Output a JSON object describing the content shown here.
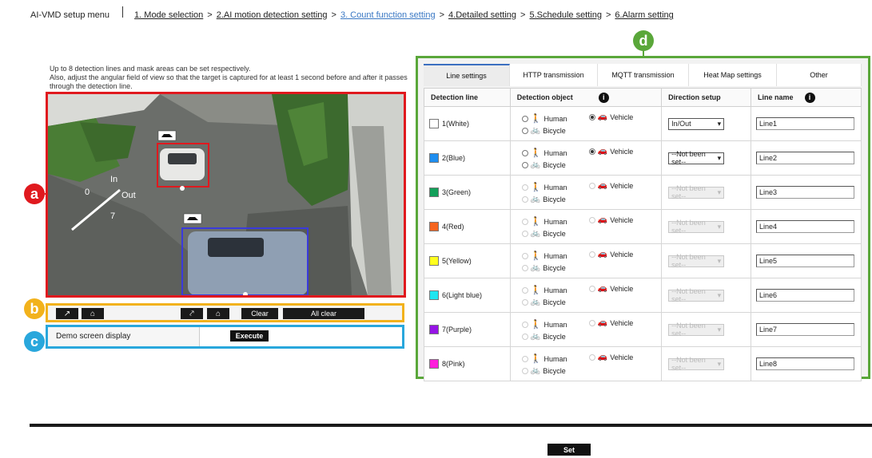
{
  "breadcrumb": {
    "menu": "AI-VMD setup menu",
    "steps": [
      "1. Mode selection",
      "2.AI motion detection setting",
      "3. Count function setting",
      "4.Detailed setting",
      "5.Schedule setting",
      "6.Alarm setting"
    ],
    "separator": ">",
    "active_index": 2
  },
  "description": "Up to 8 detection lines and mask areas can be set respectively.\nAlso, adjust the angular field of view so that the target is captured for at least 1 second before and after it passes through the detection line.",
  "callouts": {
    "a": "a",
    "b": "b",
    "c": "c",
    "d": "d"
  },
  "camera": {
    "line_label_in": "In",
    "line_label_out": "Out",
    "line_label_0": "0",
    "line_label_7": "7"
  },
  "toolbar": {
    "clear": "Clear",
    "all_clear": "All clear"
  },
  "demo": {
    "label": "Demo screen display",
    "execute": "Execute"
  },
  "tabs": [
    "Line settings",
    "HTTP transmission",
    "MQTT transmission",
    "Heat Map settings",
    "Other"
  ],
  "table": {
    "headers": [
      "Detection line",
      "Detection object",
      "Direction setup",
      "Line name"
    ],
    "object_labels": {
      "human": "Human",
      "vehicle": "Vehicle",
      "bicycle": "Bicycle"
    },
    "rows": [
      {
        "line": "1(White)",
        "color": "#ffffff",
        "direction": "In/Out",
        "name": "Line1",
        "enabled": true
      },
      {
        "line": "2(Blue)",
        "color": "#1e8ef0",
        "direction": "--Not been set--",
        "name": "Line2",
        "enabled": true
      },
      {
        "line": "3(Green)",
        "color": "#13a05a",
        "direction": "--Not been set--",
        "name": "Line3",
        "enabled": false
      },
      {
        "line": "4(Red)",
        "color": "#f5641e",
        "direction": "--Not been set--",
        "name": "Line4",
        "enabled": false
      },
      {
        "line": "5(Yellow)",
        "color": "#ffff1e",
        "direction": "--Not been set--",
        "name": "Line5",
        "enabled": false
      },
      {
        "line": "6(Light blue)",
        "color": "#1ee6f0",
        "direction": "--Not been set--",
        "name": "Line6",
        "enabled": false
      },
      {
        "line": "7(Purple)",
        "color": "#9614e6",
        "direction": "--Not been set--",
        "name": "Line7",
        "enabled": false
      },
      {
        "line": "8(Pink)",
        "color": "#ff1edc",
        "direction": "--Not been set--",
        "name": "Line8",
        "enabled": false
      }
    ]
  },
  "set_button": "Set",
  "colors": {
    "callout_a": "#e0191e",
    "callout_b": "#f2b21c",
    "callout_c": "#29a7dc",
    "callout_d": "#5aa73a",
    "active_step": "#3a78c4"
  }
}
